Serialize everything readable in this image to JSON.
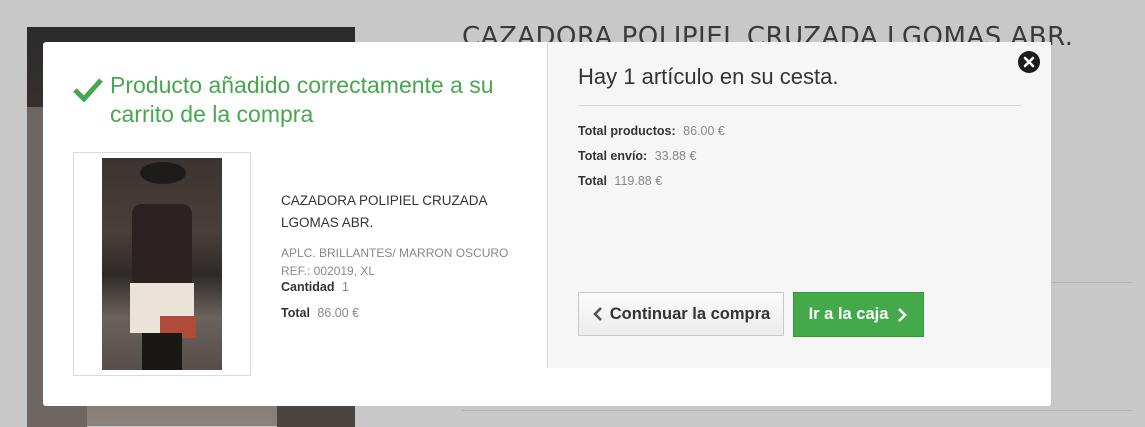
{
  "background": {
    "title": "CAZADORA POLIPIEL CRUZADA LGOMAS ABR."
  },
  "modal": {
    "success_message": "Producto añadido correctamente a su carrito de la compra",
    "product": {
      "name": "CAZADORA POLIPIEL CRUZADA LGOMAS ABR.",
      "attributes": "APLC. BRILLANTES/ MARRON OSCURO REF.: 002019, XL",
      "quantity_label": "Cantidad",
      "quantity_value": "1",
      "total_label": "Total",
      "total_value": "86.00 €"
    },
    "cart": {
      "count_text": "Hay 1 artículo en su cesta.",
      "products_label": "Total productos:",
      "products_value": "86.00 €",
      "shipping_label": "Total envío:",
      "shipping_value": "33.88 €",
      "total_label": "Total",
      "total_value": "119.88 €"
    },
    "buttons": {
      "continue_label": "Continuar la compra",
      "checkout_label": "Ir a la caja"
    },
    "icons": {
      "success": "check-icon",
      "close": "close-icon",
      "continue": "chevron-left-icon",
      "checkout": "chevron-right-icon"
    },
    "colors": {
      "success_green": "#46a74e",
      "checkout_green": "#43a94b"
    }
  }
}
